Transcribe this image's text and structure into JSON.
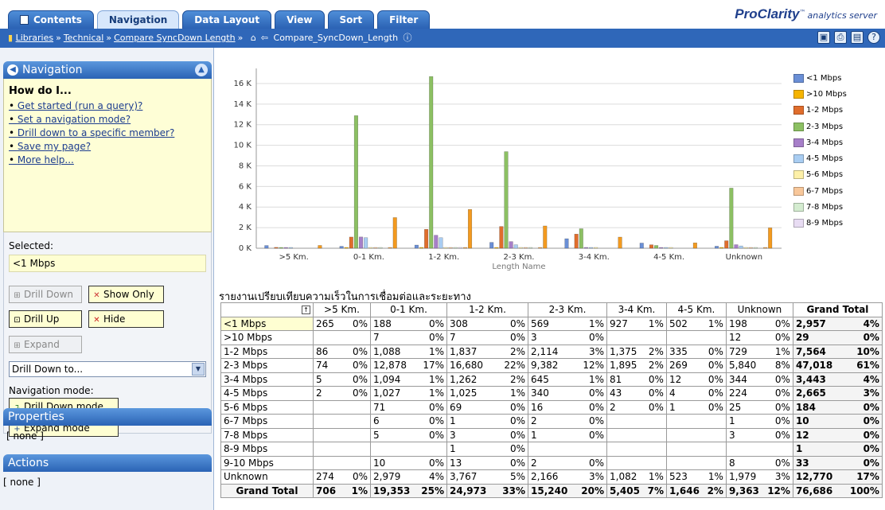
{
  "tabs": [
    {
      "label": "Contents",
      "active": false
    },
    {
      "label": "Navigation",
      "active": true
    },
    {
      "label": "Data Layout",
      "active": false
    },
    {
      "label": "View",
      "active": false
    },
    {
      "label": "Sort",
      "active": false
    },
    {
      "label": "Filter",
      "active": false
    }
  ],
  "brand": {
    "name": "ProClarity",
    "tm": "™",
    "subtitle": "analytics server"
  },
  "breadcrumb": {
    "items": [
      "Libraries",
      "Technical",
      "Compare SyncDown Length"
    ],
    "current": "Compare_SyncDown_Length"
  },
  "navigation_panel": {
    "title": "Navigation",
    "how_do_i_title": "How do I...",
    "help_links": [
      "Get started (run a query)?",
      "Set a navigation mode?",
      "Drill down to a specific member?",
      "Save my page?",
      "More help..."
    ],
    "selected_label": "Selected:",
    "selected_value": "<1 Mbps",
    "buttons": {
      "drill_down": "Drill Down",
      "show_only": "Show Only",
      "drill_up": "Drill Up",
      "hide": "Hide",
      "expand": "Expand"
    },
    "drill_down_to": "Drill Down to...",
    "navigation_mode_label": "Navigation mode:",
    "mode_buttons": {
      "drill_down_mode": "Drill Down mode",
      "expand_mode": "Expand mode"
    }
  },
  "properties": {
    "title": "Properties",
    "value": "[ none ]"
  },
  "actions": {
    "title": "Actions",
    "value": "[ none ]"
  },
  "chart_data": {
    "type": "bar",
    "title": "",
    "xlabel": "Length Name",
    "ylabel": "",
    "ylim": [
      0,
      17000
    ],
    "yticks": [
      "0 K",
      "2 K",
      "4 K",
      "6 K",
      "8 K",
      "10 K",
      "12 K",
      "14 K",
      "16 K"
    ],
    "ytick_values": [
      0,
      2000,
      4000,
      6000,
      8000,
      10000,
      12000,
      14000,
      16000
    ],
    "grid": true,
    "legend_position": "right",
    "categories": [
      ">5 Km.",
      "0-1 Km.",
      "1-2 Km.",
      "2-3 Km.",
      "3-4 Km.",
      "4-5 Km.",
      "Unknown"
    ],
    "series": [
      {
        "name": "<1 Mbps",
        "color": "#6a8fd6",
        "values": [
          265,
          188,
          308,
          569,
          927,
          502,
          198
        ]
      },
      {
        "name": ">10 Mbps",
        "color": "#f6b400",
        "values": [
          0,
          7,
          7,
          3,
          0,
          0,
          12
        ]
      },
      {
        "name": "1-2 Mbps",
        "color": "#e06d2c",
        "values": [
          86,
          1088,
          1837,
          2114,
          1375,
          335,
          729
        ]
      },
      {
        "name": "2-3 Mbps",
        "color": "#8cc063",
        "values": [
          74,
          12878,
          16680,
          9382,
          1895,
          269,
          5840
        ]
      },
      {
        "name": "3-4 Mbps",
        "color": "#a77fc9",
        "values": [
          5,
          1094,
          1262,
          645,
          81,
          12,
          344
        ]
      },
      {
        "name": "4-5 Mbps",
        "color": "#a9cdf2",
        "values": [
          2,
          1027,
          1025,
          340,
          43,
          4,
          224
        ]
      },
      {
        "name": "5-6 Mbps",
        "color": "#fdf0a8",
        "values": [
          0,
          71,
          69,
          16,
          2,
          1,
          25
        ]
      },
      {
        "name": "6-7 Mbps",
        "color": "#f8c79a",
        "values": [
          0,
          6,
          1,
          2,
          0,
          0,
          1
        ]
      },
      {
        "name": "7-8 Mbps",
        "color": "#d4ecd0",
        "values": [
          0,
          5,
          3,
          1,
          0,
          0,
          3
        ]
      },
      {
        "name": "8-9 Mbps",
        "color": "#e8dcf3",
        "values": [
          0,
          0,
          1,
          0,
          0,
          0,
          0
        ]
      },
      {
        "name": "9-10 Mbps",
        "color": "#f3a44a",
        "values": [
          0,
          10,
          13,
          2,
          0,
          0,
          8
        ]
      },
      {
        "name": "Unknown",
        "color": "#f39a1f",
        "values": [
          274,
          2979,
          3767,
          2166,
          1082,
          523,
          1979
        ]
      }
    ],
    "legend_entries": [
      "<1 Mbps",
      ">10 Mbps",
      "1-2 Mbps",
      "2-3 Mbps",
      "3-4 Mbps",
      "4-5 Mbps",
      "5-6 Mbps",
      "6-7 Mbps",
      "7-8 Mbps",
      "8-9 Mbps"
    ]
  },
  "table": {
    "title": "รายงานเปรียบเทียบความเร็วในการเชื่อมต่อและระยะทาง",
    "columns": [
      ">5 Km.",
      "0-1 Km.",
      "1-2 Km.",
      "2-3 Km.",
      "3-4 Km.",
      "4-5 Km.",
      "Unknown",
      "Grand Total"
    ],
    "rows": [
      {
        "label": "<1 Mbps",
        "cells": [
          [
            "265",
            "0%"
          ],
          [
            "188",
            "0%"
          ],
          [
            "308",
            "0%"
          ],
          [
            "569",
            "1%"
          ],
          [
            "927",
            "1%"
          ],
          [
            "502",
            "1%"
          ],
          [
            "198",
            "0%"
          ],
          [
            "2,957",
            "4%"
          ]
        ]
      },
      {
        "label": ">10 Mbps",
        "cells": [
          [
            "",
            ""
          ],
          [
            "7",
            "0%"
          ],
          [
            "7",
            "0%"
          ],
          [
            "3",
            "0%"
          ],
          [
            "",
            ""
          ],
          [
            "",
            ""
          ],
          [
            "12",
            "0%"
          ],
          [
            "29",
            "0%"
          ]
        ]
      },
      {
        "label": "1-2 Mbps",
        "cells": [
          [
            "86",
            "0%"
          ],
          [
            "1,088",
            "1%"
          ],
          [
            "1,837",
            "2%"
          ],
          [
            "2,114",
            "3%"
          ],
          [
            "1,375",
            "2%"
          ],
          [
            "335",
            "0%"
          ],
          [
            "729",
            "1%"
          ],
          [
            "7,564",
            "10%"
          ]
        ]
      },
      {
        "label": "2-3 Mbps",
        "cells": [
          [
            "74",
            "0%"
          ],
          [
            "12,878",
            "17%"
          ],
          [
            "16,680",
            "22%"
          ],
          [
            "9,382",
            "12%"
          ],
          [
            "1,895",
            "2%"
          ],
          [
            "269",
            "0%"
          ],
          [
            "5,840",
            "8%"
          ],
          [
            "47,018",
            "61%"
          ]
        ]
      },
      {
        "label": "3-4 Mbps",
        "cells": [
          [
            "5",
            "0%"
          ],
          [
            "1,094",
            "1%"
          ],
          [
            "1,262",
            "2%"
          ],
          [
            "645",
            "1%"
          ],
          [
            "81",
            "0%"
          ],
          [
            "12",
            "0%"
          ],
          [
            "344",
            "0%"
          ],
          [
            "3,443",
            "4%"
          ]
        ]
      },
      {
        "label": "4-5 Mbps",
        "cells": [
          [
            "2",
            "0%"
          ],
          [
            "1,027",
            "1%"
          ],
          [
            "1,025",
            "1%"
          ],
          [
            "340",
            "0%"
          ],
          [
            "43",
            "0%"
          ],
          [
            "4",
            "0%"
          ],
          [
            "224",
            "0%"
          ],
          [
            "2,665",
            "3%"
          ]
        ]
      },
      {
        "label": "5-6 Mbps",
        "cells": [
          [
            "",
            ""
          ],
          [
            "71",
            "0%"
          ],
          [
            "69",
            "0%"
          ],
          [
            "16",
            "0%"
          ],
          [
            "2",
            "0%"
          ],
          [
            "1",
            "0%"
          ],
          [
            "25",
            "0%"
          ],
          [
            "184",
            "0%"
          ]
        ]
      },
      {
        "label": "6-7 Mbps",
        "cells": [
          [
            "",
            ""
          ],
          [
            "6",
            "0%"
          ],
          [
            "1",
            "0%"
          ],
          [
            "2",
            "0%"
          ],
          [
            "",
            ""
          ],
          [
            "",
            ""
          ],
          [
            "1",
            "0%"
          ],
          [
            "10",
            "0%"
          ]
        ]
      },
      {
        "label": "7-8 Mbps",
        "cells": [
          [
            "",
            ""
          ],
          [
            "5",
            "0%"
          ],
          [
            "3",
            "0%"
          ],
          [
            "1",
            "0%"
          ],
          [
            "",
            ""
          ],
          [
            "",
            ""
          ],
          [
            "3",
            "0%"
          ],
          [
            "12",
            "0%"
          ]
        ]
      },
      {
        "label": "8-9 Mbps",
        "cells": [
          [
            "",
            ""
          ],
          [
            "",
            ""
          ],
          [
            "1",
            "0%"
          ],
          [
            "",
            ""
          ],
          [
            "",
            ""
          ],
          [
            "",
            ""
          ],
          [
            "",
            ""
          ],
          [
            "1",
            "0%"
          ]
        ]
      },
      {
        "label": "9-10 Mbps",
        "cells": [
          [
            "",
            ""
          ],
          [
            "10",
            "0%"
          ],
          [
            "13",
            "0%"
          ],
          [
            "2",
            "0%"
          ],
          [
            "",
            ""
          ],
          [
            "",
            ""
          ],
          [
            "8",
            "0%"
          ],
          [
            "33",
            "0%"
          ]
        ]
      },
      {
        "label": "Unknown",
        "cells": [
          [
            "274",
            "0%"
          ],
          [
            "2,979",
            "4%"
          ],
          [
            "3,767",
            "5%"
          ],
          [
            "2,166",
            "3%"
          ],
          [
            "1,082",
            "1%"
          ],
          [
            "523",
            "1%"
          ],
          [
            "1,979",
            "3%"
          ],
          [
            "12,770",
            "17%"
          ]
        ]
      }
    ],
    "total_row": {
      "label": "Grand Total",
      "cells": [
        [
          "706",
          "1%"
        ],
        [
          "19,353",
          "25%"
        ],
        [
          "24,973",
          "33%"
        ],
        [
          "15,240",
          "20%"
        ],
        [
          "5,405",
          "7%"
        ],
        [
          "1,646",
          "2%"
        ],
        [
          "9,363",
          "12%"
        ],
        [
          "76,686",
          "100%"
        ]
      ]
    }
  }
}
